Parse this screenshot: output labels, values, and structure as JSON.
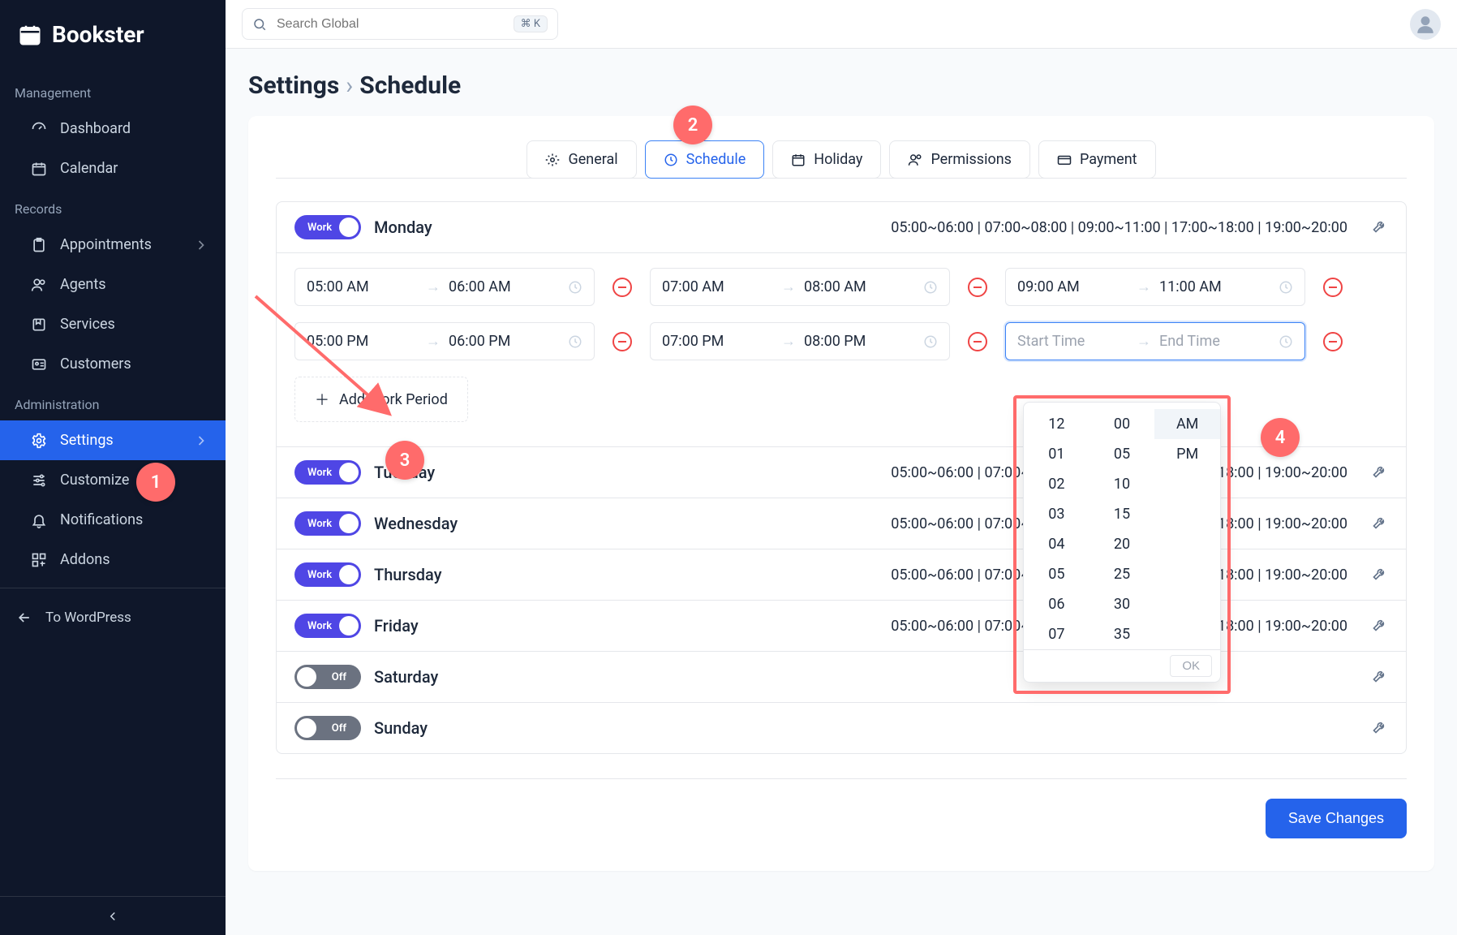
{
  "brand": "Bookster",
  "search": {
    "placeholder": "Search Global",
    "shortcut": "⌘ K"
  },
  "breadcrumb": {
    "parent": "Settings",
    "current": "Schedule"
  },
  "sidebar": {
    "heading_management": "Management",
    "heading_records": "Records",
    "heading_admin": "Administration",
    "dashboard": "Dashboard",
    "calendar": "Calendar",
    "appointments": "Appointments",
    "agents": "Agents",
    "services": "Services",
    "customers": "Customers",
    "settings": "Settings",
    "customize": "Customize",
    "notifications": "Notifications",
    "addons": "Addons",
    "back": "To WordPress"
  },
  "tabs": {
    "general": "General",
    "schedule": "Schedule",
    "holiday": "Holiday",
    "permissions": "Permissions",
    "payment": "Payment"
  },
  "switch": {
    "on_label": "Work",
    "off_label": "Off"
  },
  "days": {
    "monday": {
      "name": "Monday",
      "on": true,
      "summary": "05:00~06:00 | 07:00~08:00 | 09:00~11:00 | 17:00~18:00 | 19:00~20:00"
    },
    "tuesday": {
      "name": "Tuesday",
      "on": true,
      "summary": "05:00~06:00 | 07:00~08:00 | 09:00~11:00 | 17:00~18:00 | 19:00~20:00"
    },
    "wednesday": {
      "name": "Wednesday",
      "on": true,
      "summary": "05:00~06:00 | 07:00~08:00 | 09:00~11:00 | 17:00~18:00 | 19:00~20:00"
    },
    "thursday": {
      "name": "Thursday",
      "on": true,
      "summary": "05:00~06:00 | 07:00~08:00 | 09:00~11:00 | 17:00~18:00 | 19:00~20:00"
    },
    "friday": {
      "name": "Friday",
      "on": true,
      "summary": "05:00~06:00 | 07:00~08:00 | 09:00~11:00 | 17:00~18:00 | 19:00~20:00"
    },
    "saturday": {
      "name": "Saturday",
      "on": false,
      "summary": ""
    },
    "sunday": {
      "name": "Sunday",
      "on": false,
      "summary": ""
    }
  },
  "periods": {
    "p1": {
      "start": "05:00 AM",
      "end": "06:00 AM"
    },
    "p2": {
      "start": "07:00 AM",
      "end": "08:00 AM"
    },
    "p3": {
      "start": "09:00 AM",
      "end": "11:00 AM"
    },
    "p4": {
      "start": "05:00 PM",
      "end": "06:00 PM"
    },
    "p5": {
      "start": "07:00 PM",
      "end": "08:00 PM"
    },
    "p6_start_ph": "Start Time",
    "p6_end_ph": "End Time"
  },
  "add_period_label": "Add Work Period",
  "save_label": "Save Changes",
  "timepicker": {
    "hours": [
      "12",
      "01",
      "02",
      "03",
      "04",
      "05",
      "06",
      "07"
    ],
    "minutes": [
      "00",
      "05",
      "10",
      "15",
      "20",
      "25",
      "30",
      "35"
    ],
    "ampm": [
      "AM",
      "PM"
    ],
    "ok": "OK"
  },
  "callouts": {
    "c1": "1",
    "c2": "2",
    "c3": "3",
    "c4": "4"
  }
}
